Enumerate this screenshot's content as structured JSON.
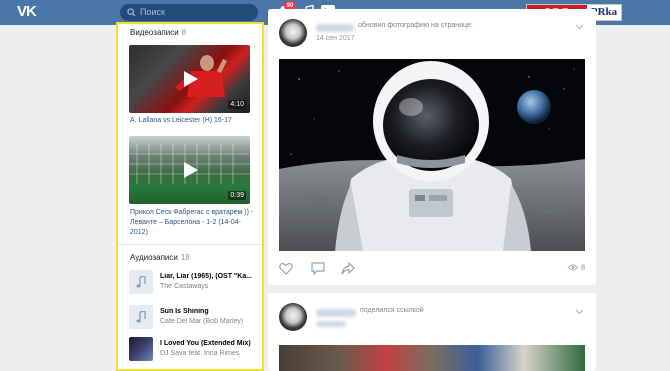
{
  "header": {
    "logo": "VK",
    "search_placeholder": "Поиск",
    "notification_badge": "90",
    "soc_logo_left": "SOC",
    "soc_logo_right": "PRka"
  },
  "videos": {
    "heading": "Видеозаписи",
    "count": "8",
    "items": [
      {
        "title": "A. Lallana vs Leicester (H) 16-17",
        "duration": "4:10"
      },
      {
        "title": "Прикол Сеск Фабрегас с вратарем )) - Леванте – Барселона - 1-2 (14-04-2012)",
        "duration": "0:39"
      }
    ]
  },
  "audios": {
    "heading": "Аудиозаписи",
    "count": "18",
    "items": [
      {
        "title": "Liar, Liar (1965), (OST \"Ka...",
        "artist": "The Castaways"
      },
      {
        "title": "Sun Is Shining",
        "artist": "Cafe Del Mar (Bob Marley)"
      },
      {
        "title": "I Loved You (Extended Mix)",
        "artist": "DJ Sava feat. Irina Rimes"
      }
    ]
  },
  "posts": [
    {
      "action": "обновил фотографию на странице:",
      "date": "14 сен 2017",
      "views": "8"
    },
    {
      "action": "поделился ссылкой"
    }
  ],
  "colors": {
    "header": "#4a76a8",
    "highlight_border": "#f0e030",
    "link": "#2a5885"
  }
}
